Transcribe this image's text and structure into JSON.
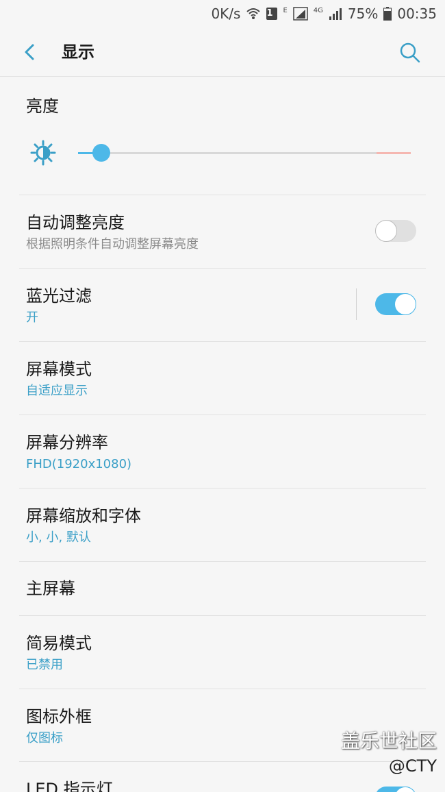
{
  "status_bar": {
    "net_speed": "0K/s",
    "sim_slot": "1",
    "net_e": "E",
    "net_4g": "4G",
    "battery": "75%",
    "time": "00:35"
  },
  "header": {
    "title": "显示"
  },
  "brightness": {
    "label": "亮度",
    "level": 0.07
  },
  "items": [
    {
      "title": "自动调整亮度",
      "subtitle": "根据照明条件自动调整屏幕亮度",
      "toggle": "off"
    },
    {
      "title": "蓝光过滤",
      "subtitle": "开",
      "toggle": "on"
    },
    {
      "title": "屏幕模式",
      "subtitle": "自适应显示"
    },
    {
      "title": "屏幕分辨率",
      "subtitle": "FHD(1920x1080)"
    },
    {
      "title": "屏幕缩放和字体",
      "subtitle": "小, 小, 默认"
    },
    {
      "title": "主屏幕"
    },
    {
      "title": "简易模式",
      "subtitle": "已禁用"
    },
    {
      "title": "图标外框",
      "subtitle": "仅图标"
    },
    {
      "title": "LED 指示灯",
      "toggle": "on"
    }
  ],
  "watermark": {
    "line1": "盖乐世社区",
    "line2": "@CTY"
  },
  "colors": {
    "accent": "#4db8e8",
    "subtitle_blue": "#3a9fc7",
    "background": "#f6f6f6"
  }
}
